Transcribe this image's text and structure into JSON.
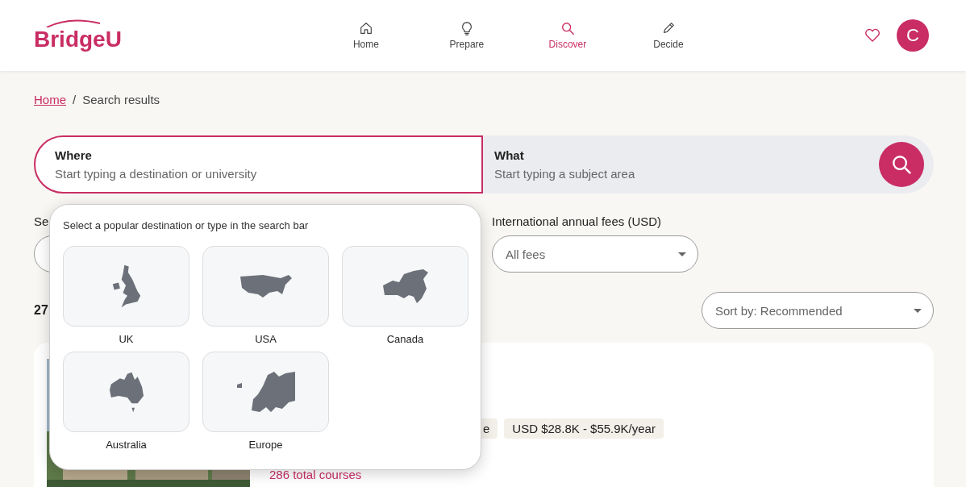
{
  "header": {
    "logo": "BridgeU",
    "nav": [
      {
        "label": "Home",
        "kind": "home",
        "selected": false
      },
      {
        "label": "Prepare",
        "kind": "bulb",
        "selected": false
      },
      {
        "label": "Discover",
        "kind": "search",
        "selected": true
      },
      {
        "label": "Decide",
        "kind": "pencil",
        "selected": false
      }
    ],
    "avatar": "C"
  },
  "breadcrumb": {
    "link": "Home",
    "separator": "/",
    "current": "Search results"
  },
  "search": {
    "where": {
      "label": "Where",
      "placeholder": "Start typing a destination or university"
    },
    "what": {
      "label": "What",
      "placeholder": "Start typing a subject area"
    }
  },
  "filters": {
    "first_label": "Se",
    "fees_label": "International annual fees (USD)",
    "fees_value": "All fees"
  },
  "results": {
    "count": "27",
    "sort": "Sort by: Recommended"
  },
  "card": {
    "tags": [
      "e",
      "USD $28.8K - $55.9K/year"
    ],
    "courses": "286 total courses"
  },
  "popup": {
    "title": "Select a popular destination or type in the search bar",
    "destinations": [
      {
        "label": "UK",
        "kind": "uk"
      },
      {
        "label": "USA",
        "kind": "usa"
      },
      {
        "label": "Canada",
        "kind": "canada"
      },
      {
        "label": "Australia",
        "kind": "australia"
      },
      {
        "label": "Europe",
        "kind": "europe"
      }
    ]
  }
}
